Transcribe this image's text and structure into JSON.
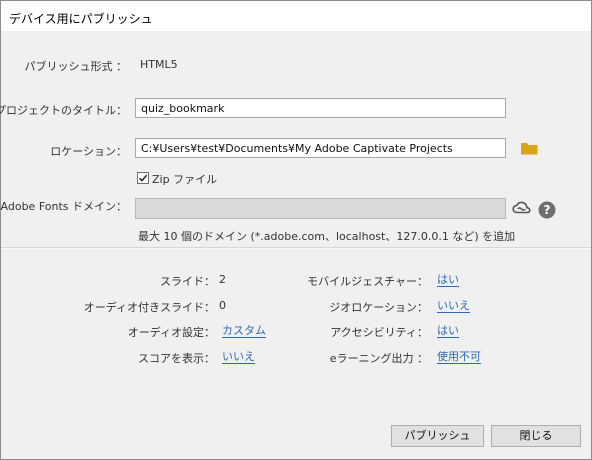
{
  "window": {
    "title": "デバイス用にパブリッシュ"
  },
  "publish_format": {
    "label": "パブリッシュ形式 ：",
    "value": "HTML5"
  },
  "project_title": {
    "label": "プロジェクトのタイトル：",
    "value": "quiz_bookmark"
  },
  "location": {
    "label": "ロケーション：",
    "value": "C:¥Users¥test¥Documents¥My Adobe Captivate Projects",
    "folder_icon": "folder-icon"
  },
  "zip": {
    "label": "Zip ファイル",
    "checked": true
  },
  "adobe_fonts": {
    "label": "Adobe Fonts ドメイン：",
    "value": "",
    "hint": "最大 10 個のドメイン (*.adobe.com、localhost、127.0.0.1 など) を追加",
    "cc_icon": "creative-cloud-icon",
    "help_icon": "help-icon"
  },
  "summary": {
    "slides": {
      "label": "スライド：",
      "value": "2"
    },
    "audio_slides": {
      "label": "オーディオ付きスライド：",
      "value": "0"
    },
    "audio_settings": {
      "label": "オーディオ設定：",
      "value": "カスタム"
    },
    "show_score": {
      "label": "スコアを表示：",
      "value": "いいえ"
    },
    "mobile_gestures": {
      "label": "モバイルジェスチャー：",
      "value": "はい"
    },
    "geolocation": {
      "label": "ジオロケーション：",
      "value": "いいえ"
    },
    "accessibility": {
      "label": "アクセシビリティ：",
      "value": "はい"
    },
    "elearning_output": {
      "label": "eラーニング出力 ：",
      "value": "使用不可"
    }
  },
  "buttons": {
    "publish": "パブリッシュ",
    "close": "閉じる"
  }
}
